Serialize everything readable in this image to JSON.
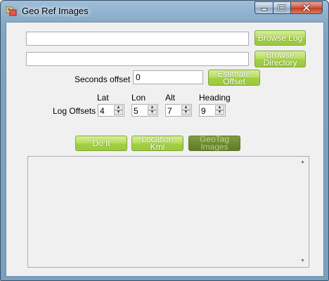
{
  "window": {
    "title": "Geo Ref Images"
  },
  "browse_log": {
    "path_value": "",
    "button_label": "Browse Log"
  },
  "browse_directory": {
    "path_value": "",
    "button_label": "Browse Directory"
  },
  "seconds_offset": {
    "label": "Seconds offset",
    "value": "0",
    "estimate_label": "Estimate Offset"
  },
  "log_offsets": {
    "label": "Log Offsets",
    "fields": [
      {
        "name": "Lat",
        "value": "4"
      },
      {
        "name": "Lon",
        "value": "5"
      },
      {
        "name": "Alt",
        "value": "7"
      },
      {
        "name": "Heading",
        "value": "9"
      }
    ]
  },
  "actions": {
    "do_it": "Do It",
    "location_kml": "Location Kml",
    "geotag_images": "GeoTag Images"
  },
  "output": {
    "text": ""
  },
  "icons": {
    "app": "app-icon",
    "minimize": "minimize-icon",
    "maximize": "maximize-icon",
    "close": "close-icon"
  },
  "colors": {
    "button_green": "#a2cf43",
    "button_disabled": "#6c8b32",
    "titlebar": "#86aac8",
    "form_background": "#f0f0f0"
  }
}
